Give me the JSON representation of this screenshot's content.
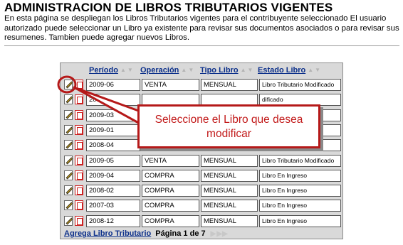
{
  "page": {
    "title": "ADMINISTRACION DE LIBROS TRIBUTARIOS VIGENTES",
    "description": "En esta página se despliegan los Libros Tributarios vigentes para el contribuyente seleccionado El usuario autorizado puede seleccionar un Libro ya existente para revisar sus documentos asociados o para revisar sus resumenes. Tambien puede agregar nuevos Libros."
  },
  "table": {
    "headers": [
      "Período",
      "Operación",
      "Tipo Libro",
      "Estado Libro"
    ],
    "rows": [
      {
        "periodo": "2009-06",
        "operacion": "VENTA",
        "tipo": "MENSUAL",
        "estado": "Libro Tributario Modificado"
      },
      {
        "periodo": "20",
        "operacion": "",
        "tipo": "",
        "estado": "dificado"
      },
      {
        "periodo": "2009-03",
        "operacion": "",
        "tipo": "",
        "estado": "dificado"
      },
      {
        "periodo": "2009-01",
        "operacion": "",
        "tipo": "",
        "estado": ""
      },
      {
        "periodo": "2008-04",
        "operacion": "",
        "tipo": "",
        "estado": "dificado"
      },
      {
        "periodo": "2009-05",
        "operacion": "VENTA",
        "tipo": "MENSUAL",
        "estado": "Libro Tributario Modificado"
      },
      {
        "periodo": "2009-04",
        "operacion": "COMPRA",
        "tipo": "MENSUAL",
        "estado": "Libro En Ingreso"
      },
      {
        "periodo": "2008-02",
        "operacion": "COMPRA",
        "tipo": "MENSUAL",
        "estado": "Libro En Ingreso"
      },
      {
        "periodo": "2007-03",
        "operacion": "COMPRA",
        "tipo": "MENSUAL",
        "estado": "Libro En Ingreso"
      },
      {
        "periodo": "2008-12",
        "operacion": "COMPRA",
        "tipo": "MENSUAL",
        "estado": "Libro En Ingreso"
      }
    ]
  },
  "footer": {
    "add_label": "Agrega Libro Tributario",
    "page_label": "Página 1 de 7"
  },
  "callout": {
    "line1": "Seleccione el Libro que desea",
    "line2": "modificar"
  },
  "icons": {
    "edit": "pencil-edit-icon",
    "document": "red-document-icon",
    "sort": "sort-arrows-icon",
    "next": "next-page-icon"
  },
  "colors": {
    "link": "#0b2f8a",
    "callout_border": "#b51919",
    "callout_text": "#c21a1a",
    "grid_background": "#d9d9d9"
  }
}
